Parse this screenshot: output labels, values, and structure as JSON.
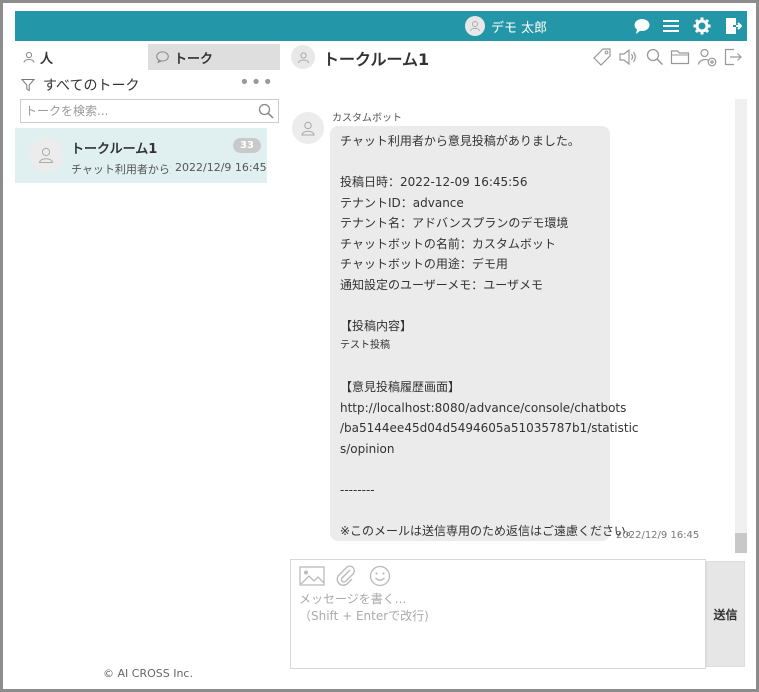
{
  "topbar": {
    "user_name": "デモ 太郎",
    "accent": "#2396a8",
    "icons": [
      "chat-icon",
      "menu-icon",
      "gear-icon",
      "logout-icon"
    ]
  },
  "left": {
    "tabs": [
      {
        "label": "人",
        "icon": "person-icon"
      },
      {
        "label": "トーク",
        "icon": "speech-bubble-icon"
      }
    ],
    "filter_label": "すべてのトーク",
    "search_placeholder": "トークを検索...",
    "rooms": [
      {
        "name": "トークルーム1",
        "badge": "33",
        "preview": "チャット利用者から意見",
        "time": "2022/12/9 16:45"
      }
    ],
    "copyright": "© AI CROSS Inc."
  },
  "room": {
    "title": "トークルーム1",
    "header_icons": [
      "tag-icon",
      "speaker-icon",
      "search-icon",
      "folder-icon",
      "add-user-icon",
      "leave-icon"
    ]
  },
  "message": {
    "sender": "カスタムボット",
    "lines": [
      "チャット利用者から意見投稿がありました。",
      "",
      "投稿日時：2022-12-09 16:45:56",
      "テナントID：advance",
      "テナント名：アドバンスプランのデモ環境",
      "チャットボットの名前：カスタムボット",
      "チャットボットの用途：デモ用",
      "通知設定のユーザーメモ：ユーザメモ",
      "",
      "【投稿内容】",
      "テスト投稿",
      "",
      "【意見投稿履歴画面】",
      "http://localhost:8080/advance/console/chatbots",
      "/ba5144ee45d04d5494605a51035787b1/statistic",
      "s/opinion",
      "",
      "--------",
      "",
      "※このメールは送信専用のため返信はご遠慮ください。"
    ],
    "time": "2022/12/9 16:45"
  },
  "composer": {
    "placeholder": "メッセージを書く...\n（Shift + Enterで改行)",
    "send_label": "送信",
    "icons": [
      "image-icon",
      "paperclip-icon",
      "smiley-icon"
    ]
  }
}
